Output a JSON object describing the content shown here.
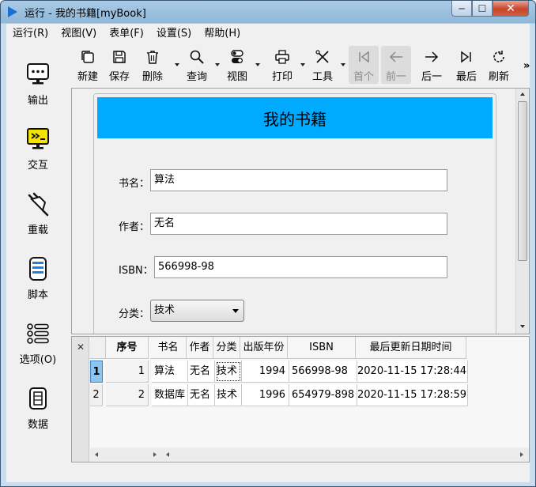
{
  "window": {
    "title": "运行 - 我的书籍[myBook]",
    "minimize_glyph": "─",
    "maximize_glyph": "☐",
    "close_glyph": "✕"
  },
  "menu": [
    "运行(R)",
    "视图(V)",
    "表单(F)",
    "设置(S)",
    "帮助(H)"
  ],
  "sidebar": [
    {
      "label": "输出",
      "icon": "monitor-icon"
    },
    {
      "label": "交互",
      "icon": "terminal-icon"
    },
    {
      "label": "重载",
      "icon": "plug-icon"
    },
    {
      "label": "脚本",
      "icon": "script-icon"
    },
    {
      "label": "选项(O)",
      "icon": "options-icon"
    },
    {
      "label": "数据",
      "icon": "database-icon"
    }
  ],
  "toolbar": [
    {
      "label": "新建",
      "icon": "new-icon",
      "dropdown": false,
      "disabled": false
    },
    {
      "label": "保存",
      "icon": "save-icon",
      "dropdown": false,
      "disabled": false
    },
    {
      "label": "删除",
      "icon": "delete-icon",
      "dropdown": true,
      "disabled": false
    },
    {
      "label": "查询",
      "icon": "search-icon",
      "dropdown": true,
      "disabled": false
    },
    {
      "label": "视图",
      "icon": "toggle-icon",
      "dropdown": true,
      "disabled": false
    },
    {
      "label": "打印",
      "icon": "print-icon",
      "dropdown": true,
      "disabled": false
    },
    {
      "label": "工具",
      "icon": "tools-icon",
      "dropdown": true,
      "disabled": false
    },
    {
      "label": "首个",
      "icon": "first-icon",
      "dropdown": false,
      "disabled": true
    },
    {
      "label": "前一",
      "icon": "prev-icon",
      "dropdown": false,
      "disabled": true
    },
    {
      "label": "后一",
      "icon": "next-icon",
      "dropdown": false,
      "disabled": false
    },
    {
      "label": "最后",
      "icon": "last-icon",
      "dropdown": false,
      "disabled": false
    },
    {
      "label": "刷新",
      "icon": "refresh-icon",
      "dropdown": false,
      "disabled": false
    }
  ],
  "toolbar_more": "»",
  "form": {
    "title": "我的书籍",
    "header_color": "#00aaff",
    "fields": {
      "name_label": "书名：",
      "name_value": "算法",
      "author_label": "作者：",
      "author_value": "无名",
      "isbn_label": "ISBN：",
      "isbn_value": "566998-98",
      "category_label": "分类：",
      "category_value": "技术"
    }
  },
  "table": {
    "close_glyph": "✕",
    "columns": [
      "序号",
      "书名",
      "作者",
      "分类",
      "出版年份",
      "ISBN",
      "最后更新日期时间"
    ],
    "rows": [
      {
        "row_no": "1",
        "seq": "1",
        "name": "算法",
        "author": "无名",
        "category": "技术",
        "year": "1994",
        "isbn": "566998-98",
        "updated": "2020-11-15 17:28:44"
      },
      {
        "row_no": "2",
        "seq": "2",
        "name": "数据库",
        "author": "无名",
        "category": "技术",
        "year": "1996",
        "isbn": "654979-898",
        "updated": "2020-11-15 17:28:59"
      }
    ],
    "selected_row": 1
  }
}
